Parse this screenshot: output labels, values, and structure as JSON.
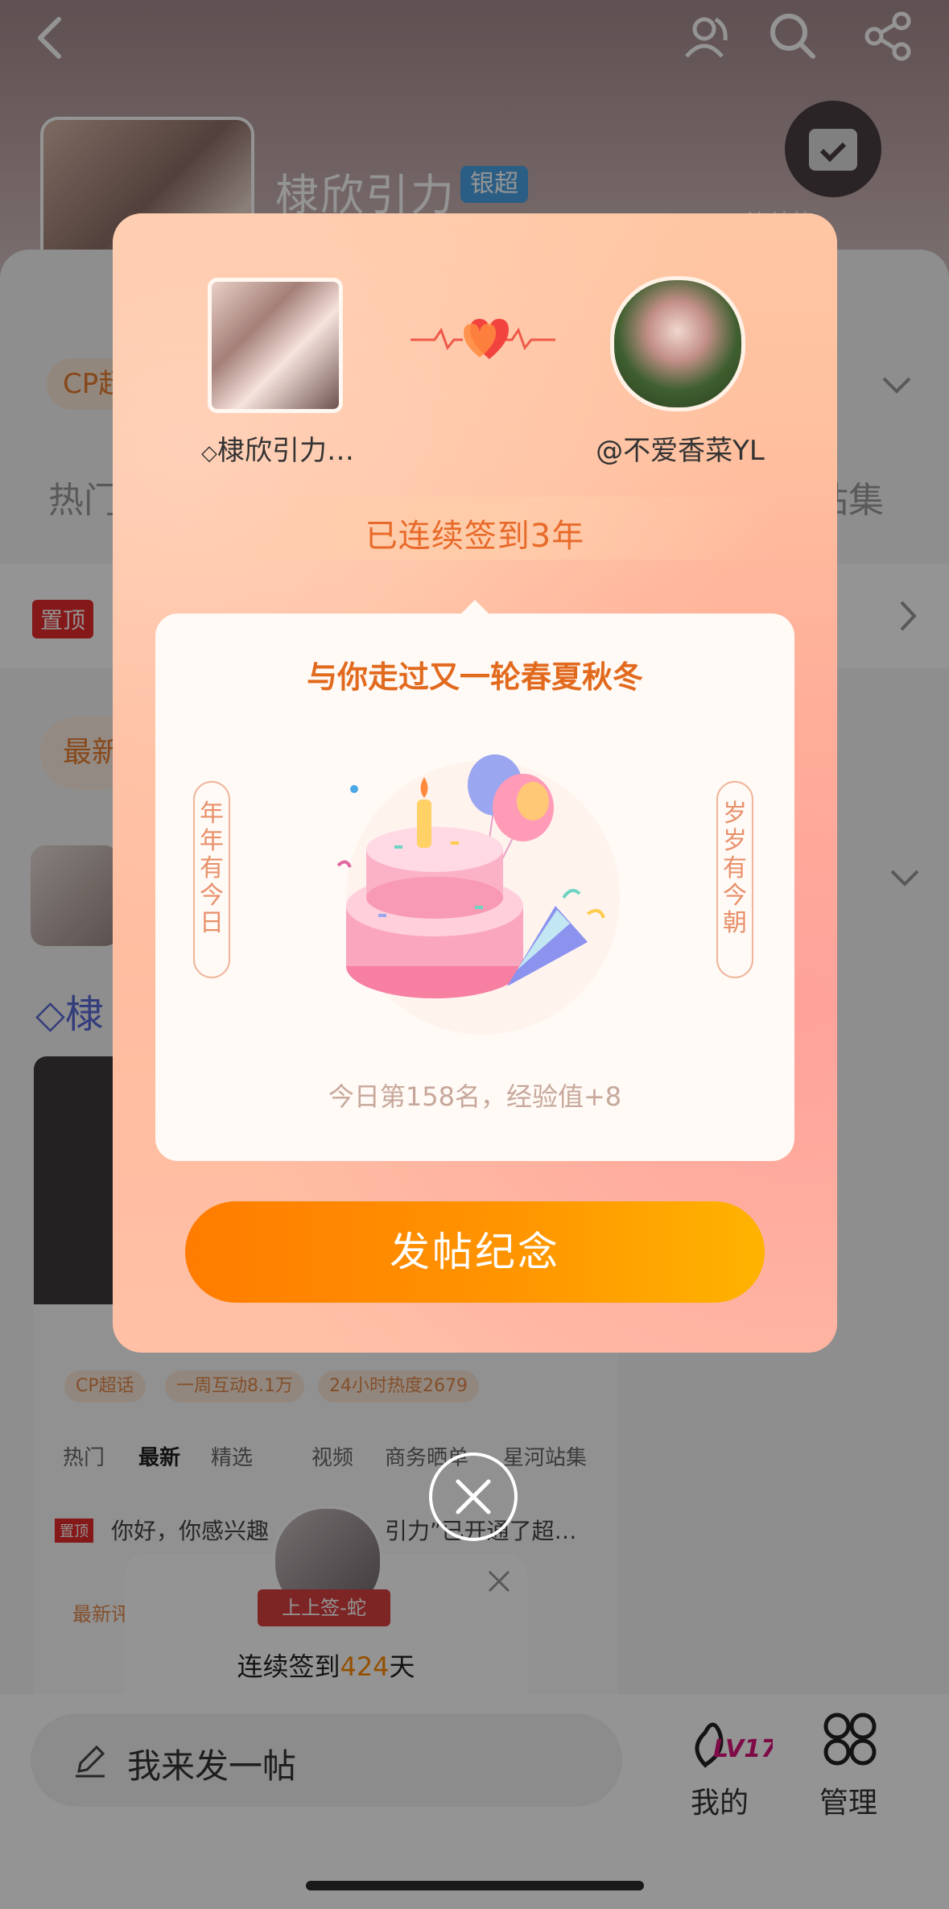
{
  "header": {
    "forum_title": "棣欣引力",
    "badge_label": "银超",
    "streak_tiny": "连续签"
  },
  "tabs": {
    "cp_chip": "CP超",
    "hot": "热门",
    "station": "站集"
  },
  "pinned": {
    "badge": "置顶"
  },
  "newest": {
    "chip": "最新"
  },
  "post": {
    "author_prefix": "棣",
    "mini_chips": [
      "CP超话",
      "一周互动8.1万",
      "24小时热度2679"
    ],
    "mini_tabs": [
      "热门",
      "最新",
      "精选",
      "视频",
      "商务晒单",
      "星河站集"
    ],
    "mini_pinned_badge": "置顶",
    "mini_pinned_text": "你好，你感兴趣",
    "mini_pinned_text2": "引力”已开通了超…",
    "mini_newest": "最新评"
  },
  "modal": {
    "left_name": "棣欣引力…",
    "right_name": "@不爱香菜YL",
    "streak": "已连续签到3年",
    "card_title": "与你走过又一轮春夏秋冬",
    "left_scroll": "年年有今日",
    "right_scroll": "岁岁有今朝",
    "rank_text": "今日第158名，经验值+8",
    "post_button": "发帖纪念"
  },
  "toast": {
    "ribbon": "上上签-蛇",
    "text_prefix": "连续签到",
    "days": "424",
    "text_suffix": "天"
  },
  "bottom_bar": {
    "compose_placeholder": "我来发一帖",
    "level_badge": "LV17",
    "mine_label": "我的",
    "manage_label": "管理"
  },
  "colors": {
    "accent_orange": "#e86a2a",
    "button_start": "#ff7c00",
    "button_end": "#ffb300",
    "level_pink": "#d9147a",
    "silver_badge": "#4aa3e6"
  },
  "icons": [
    "back-icon",
    "friends-icon",
    "search-icon",
    "share-icon",
    "calendar-check-icon",
    "chevron-down-icon",
    "chevron-right-icon",
    "heartbeat-icon",
    "cake-illustration",
    "close-icon",
    "pencil-icon",
    "level-icon",
    "grid-icon",
    "diamond-icon"
  ]
}
